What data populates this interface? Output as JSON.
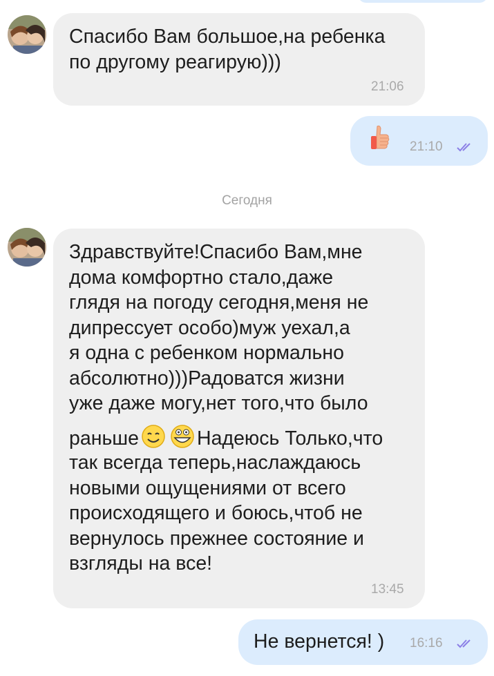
{
  "date_separator": "Сегодня",
  "messages": [
    {
      "direction": "incoming",
      "text": "Спасибо Вам большое,на ребенка\nпо другому реагирую)))",
      "time": "21:06"
    },
    {
      "direction": "outgoing",
      "content": "thumbs-up-sticker",
      "time": "21:10",
      "status": "read"
    },
    {
      "direction": "incoming",
      "text_part1": "Здравствуйте!Спасибо Вам,мне\nдома комфортно стало,даже\nглядя на погоду сегодня,меня не\nдипрессует особо)муж уехал,а\nя одна с ребенком нормально\nабсолютно)))Радоватся жизни\nуже даже могу,нет того,что было",
      "text_line8_before_emoji": "раньше",
      "emojis": [
        "smiling-face-emoji",
        "grinning-face-emoji"
      ],
      "text_line8_after_emoji": "Надеюсь Только,что",
      "text_part3": "так всегда теперь,наслаждаюсь\nновыми ощущениями от всего\nпроисходящего и боюсь,чтоб не\nвернулось прежнее состояние и\nвзгляды на все!",
      "time": "13:45"
    },
    {
      "direction": "outgoing",
      "text": "Не вернется! )",
      "time": "16:16",
      "status": "read"
    }
  ],
  "colors": {
    "incoming_bubble": "#efefef",
    "outgoing_bubble": "#dcecfd",
    "read_ticks": "#8b7fe6",
    "timestamp": "#a9a9a9"
  }
}
